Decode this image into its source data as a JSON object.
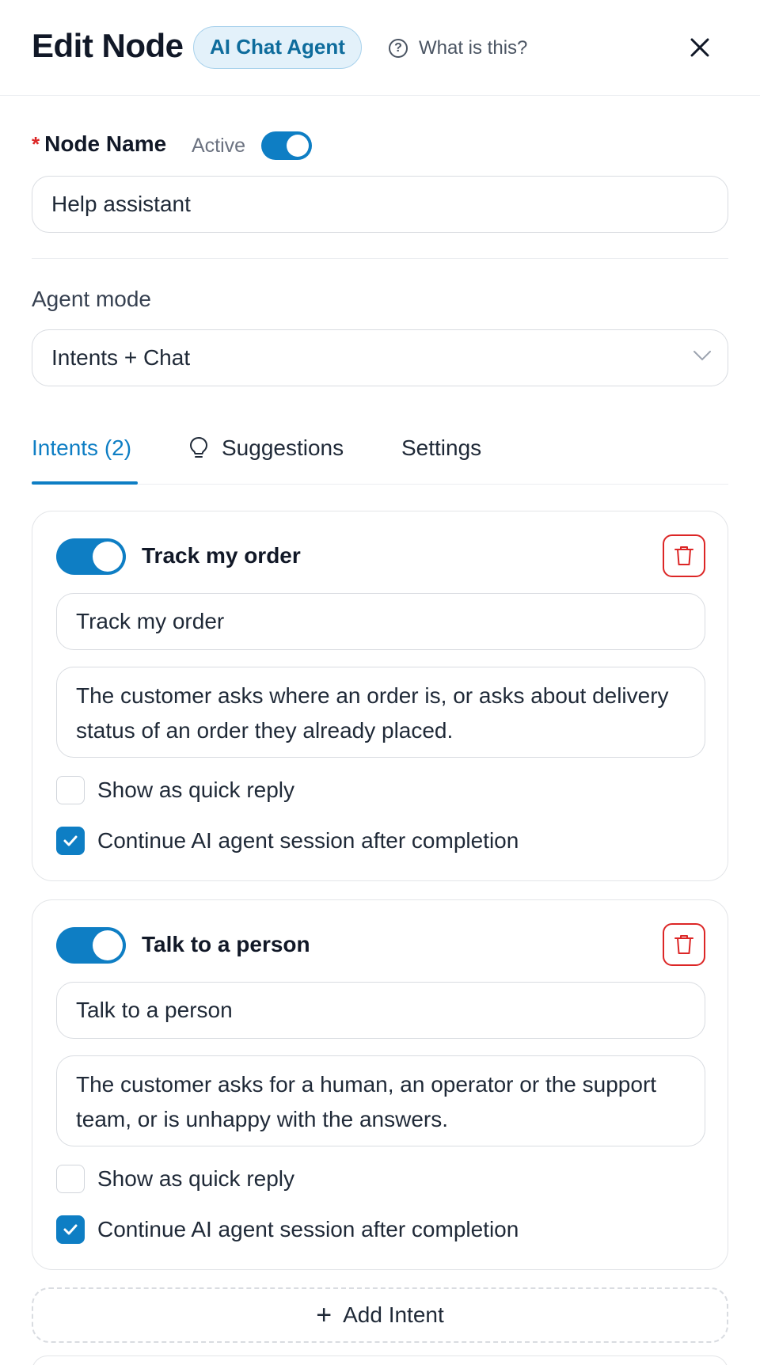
{
  "header": {
    "title": "Edit Node",
    "node_type": "AI Chat Agent",
    "help_label": "What is this?"
  },
  "node_name": {
    "label": "Node Name",
    "required_marker": "*",
    "active_label": "Active",
    "active": true,
    "value": "Help assistant"
  },
  "agent_mode": {
    "label": "Agent mode",
    "value": "Intents + Chat"
  },
  "tabs": [
    {
      "label": "Intents (2)",
      "active": true
    },
    {
      "label": "Suggestions",
      "icon": "lightbulb-icon",
      "active": false
    },
    {
      "label": "Settings",
      "active": false
    }
  ],
  "intents": [
    {
      "enabled": true,
      "title": "Track my order",
      "name_value": "Track my order",
      "description": "The customer asks where an order is, or asks about delivery status of an order they already placed.",
      "quick_reply_label": "Show as quick reply",
      "quick_reply": false,
      "continue_label": "Continue AI agent session after completion",
      "continue_session": true
    },
    {
      "enabled": true,
      "title": "Talk to a person",
      "name_value": "Talk to a person",
      "description": "The customer asks for a human, an operator or the support team, or is unhappy with the answers.",
      "quick_reply_label": "Show as quick reply",
      "quick_reply": false,
      "continue_label": "Continue AI agent session after completion",
      "continue_session": true
    }
  ],
  "add_intent_label": "Add Intent",
  "colors": {
    "accent": "#0e7ec4",
    "danger": "#dc2626",
    "badge_bg": "#e3f1fa",
    "badge_text": "#0e6c9c"
  }
}
